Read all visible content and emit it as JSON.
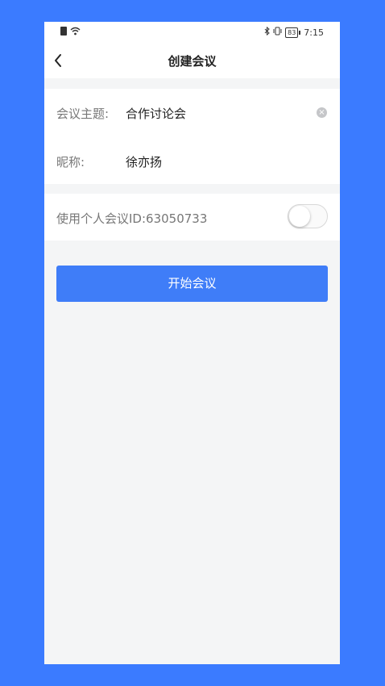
{
  "status_bar": {
    "time": "7:15",
    "battery": "83",
    "icons": [
      "sim-icon",
      "wifi-icon",
      "bluetooth-icon",
      "vibrate-icon",
      "battery-icon"
    ]
  },
  "nav": {
    "title": "创建会议",
    "back_icon": "chevron-left-icon"
  },
  "form": {
    "topic_label": "会议主题:",
    "topic_value": "合作讨论会",
    "nickname_label": "昵称:",
    "nickname_value": "徐亦扬",
    "pmi_label": "使用个人会议ID:63050733",
    "pmi_enabled": false
  },
  "actions": {
    "start_label": "开始会议"
  },
  "colors": {
    "background": "#3b7bff",
    "accent": "#3f7df8",
    "page": "#f4f5f6"
  }
}
